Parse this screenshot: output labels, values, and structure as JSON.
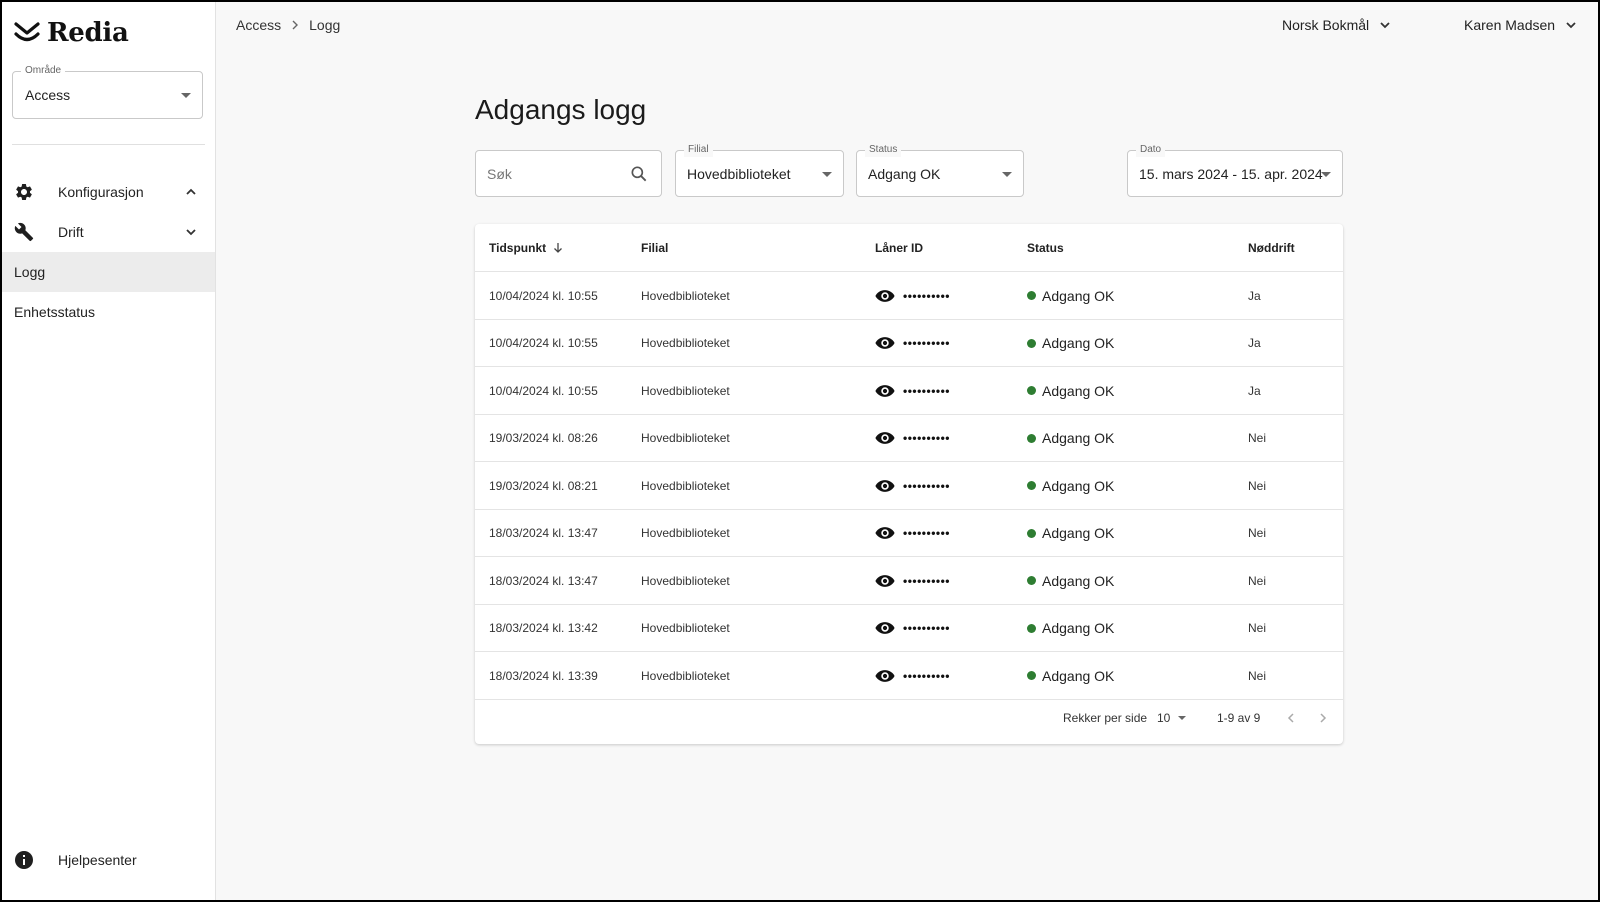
{
  "sidebar": {
    "logo_text": "Redia",
    "area": {
      "label": "Område",
      "value": "Access"
    },
    "groups": [
      {
        "label": "Konfigurasjon",
        "icon": "gear-icon",
        "expanded": true
      },
      {
        "label": "Drift",
        "icon": "wrench-icon",
        "expanded": false
      }
    ],
    "items": [
      {
        "label": "Logg",
        "active": true
      },
      {
        "label": "Enhetsstatus",
        "active": false
      }
    ],
    "help_label": "Hjelpesenter"
  },
  "breadcrumb": {
    "root": "Access",
    "current": "Logg"
  },
  "topbar": {
    "language": "Norsk Bokmål",
    "user": "Karen Madsen"
  },
  "page": {
    "title": "Adgangs logg"
  },
  "filters": {
    "search": {
      "placeholder": "Søk"
    },
    "branch": {
      "label": "Filial",
      "value": "Hovedbiblioteket"
    },
    "status": {
      "label": "Status",
      "value": "Adgang OK"
    },
    "date": {
      "label": "Dato",
      "value": "15. mars 2024 - 15. apr. 2024"
    }
  },
  "table": {
    "columns": {
      "time": "Tidspunkt",
      "branch": "Filial",
      "patron": "Låner ID",
      "status": "Status",
      "emergency": "Nøddrift"
    },
    "sort": {
      "column": "Tidspunkt",
      "direction": "descending"
    },
    "status_color": "#2e7d32",
    "rows": [
      {
        "time": "10/04/2024 kl. 10:55",
        "branch": "Hovedbiblioteket",
        "patron": "••••••••••",
        "status": "Adgang OK",
        "emergency": "Ja"
      },
      {
        "time": "10/04/2024 kl. 10:55",
        "branch": "Hovedbiblioteket",
        "patron": "••••••••••",
        "status": "Adgang OK",
        "emergency": "Ja"
      },
      {
        "time": "10/04/2024 kl. 10:55",
        "branch": "Hovedbiblioteket",
        "patron": "••••••••••",
        "status": "Adgang OK",
        "emergency": "Ja"
      },
      {
        "time": "19/03/2024 kl. 08:26",
        "branch": "Hovedbiblioteket",
        "patron": "••••••••••",
        "status": "Adgang OK",
        "emergency": "Nei"
      },
      {
        "time": "19/03/2024 kl. 08:21",
        "branch": "Hovedbiblioteket",
        "patron": "••••••••••",
        "status": "Adgang OK",
        "emergency": "Nei"
      },
      {
        "time": "18/03/2024 kl. 13:47",
        "branch": "Hovedbiblioteket",
        "patron": "••••••••••",
        "status": "Adgang OK",
        "emergency": "Nei"
      },
      {
        "time": "18/03/2024 kl. 13:47",
        "branch": "Hovedbiblioteket",
        "patron": "••••••••••",
        "status": "Adgang OK",
        "emergency": "Nei"
      },
      {
        "time": "18/03/2024 kl. 13:42",
        "branch": "Hovedbiblioteket",
        "patron": "••••••••••",
        "status": "Adgang OK",
        "emergency": "Nei"
      },
      {
        "time": "18/03/2024 kl. 13:39",
        "branch": "Hovedbiblioteket",
        "patron": "••••••••••",
        "status": "Adgang OK",
        "emergency": "Nei"
      }
    ]
  },
  "pagination": {
    "rows_per_page_label": "Rekker per side",
    "rows_per_page": "10",
    "range": "1-9 av 9"
  }
}
